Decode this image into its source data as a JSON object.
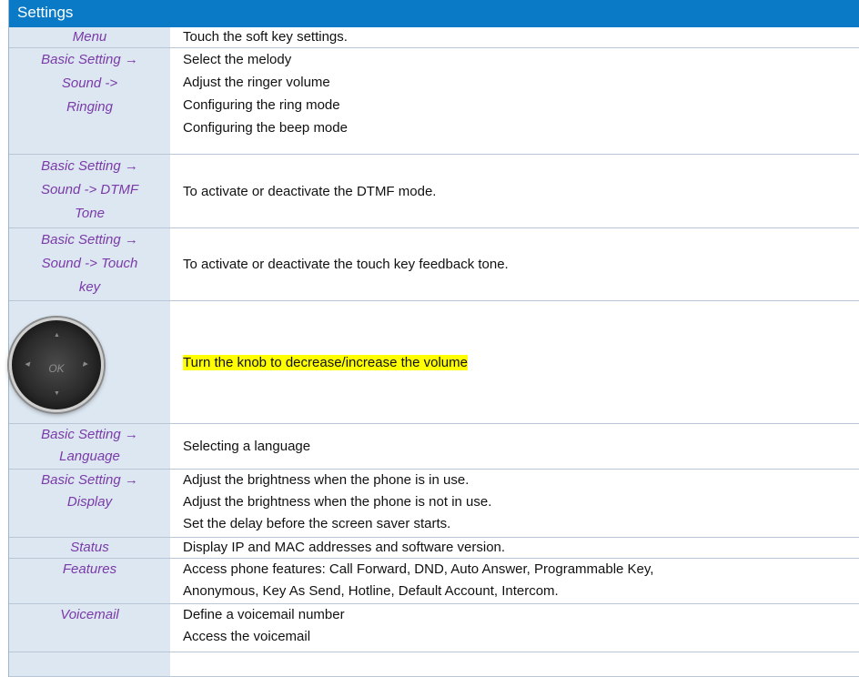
{
  "title": "Settings",
  "rows": [
    {
      "left": [
        "Menu"
      ],
      "right": [
        "Touch the soft key settings."
      ]
    },
    {
      "left": [
        "Basic Setting →",
        "Sound ->",
        "Ringing"
      ],
      "right": [
        "Select the melody",
        "Adjust the ringer volume",
        "Configuring the ring mode",
        "Configuring the beep mode"
      ]
    },
    {
      "left": [
        "Basic Setting →",
        "Sound -> DTMF",
        "Tone"
      ],
      "right": [
        "To activate or deactivate the DTMF mode."
      ]
    },
    {
      "left": [
        "Basic Setting →",
        "Sound -> Touch",
        "key"
      ],
      "right": [
        "To activate or deactivate the touch key feedback tone."
      ]
    },
    {
      "knob_label": "OK",
      "right": [
        "Turn the knob to decrease/increase the volume"
      ]
    },
    {
      "left": [
        "Basic Setting →",
        "Language"
      ],
      "right": [
        "Selecting a language"
      ]
    },
    {
      "left": [
        "Basic Setting →",
        "Display"
      ],
      "right": [
        "Adjust the brightness when the phone is in use.",
        "Adjust the brightness when the phone is not in use.",
        "Set the delay before the screen saver starts."
      ]
    },
    {
      "left": [
        "Status"
      ],
      "right": [
        "Display IP and MAC addresses and software version."
      ]
    },
    {
      "left": [
        "Features"
      ],
      "right": [
        "Access phone features: Call Forward, DND, Auto Answer, Programmable Key,",
        "Anonymous, Key As Send, Hotline, Default Account, Intercom."
      ]
    },
    {
      "left": [
        "Voicemail"
      ],
      "right": [
        "Define a voicemail number",
        "Access the voicemail"
      ]
    }
  ],
  "colors": {
    "header": "#0a7ac6",
    "left_bg": "#dce7f2",
    "left_text": "#7a3aa8",
    "highlight": "#ffff00"
  }
}
